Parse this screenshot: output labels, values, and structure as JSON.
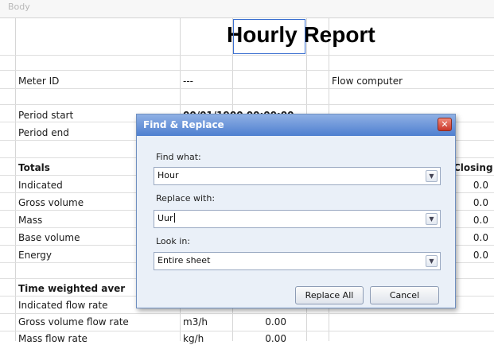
{
  "sheet": {
    "corner_label": "Body",
    "title": "Hourly Report",
    "meter_id_label": "Meter ID",
    "meter_id_value": "---",
    "flow_computer_label": "Flow computer",
    "period_start_label": "Period start",
    "period_start_value": "00/01/1900 00:00:00",
    "period_end_label": "Period end",
    "totals_label": "Totals",
    "closing_header": "Closing",
    "totals_rows": [
      {
        "label": "Indicated",
        "closing": "0.0"
      },
      {
        "label": "Gross volume",
        "closing": "0.0"
      },
      {
        "label": "Mass",
        "closing": "0.0"
      },
      {
        "label": "Base volume",
        "closing": "0.0"
      },
      {
        "label": "Energy",
        "closing": "0.0"
      }
    ],
    "time_weighted_label": "Time weighted aver",
    "flow_rows": [
      {
        "label": "Indicated flow rate",
        "unit": "",
        "value": ""
      },
      {
        "label": "Gross volume flow rate",
        "unit": "m3/h",
        "value": "0.00"
      },
      {
        "label": "Mass flow rate",
        "unit": "kg/h",
        "value": "0.00"
      }
    ]
  },
  "dialog": {
    "title": "Find & Replace",
    "close_symbol": "✕",
    "find_label": "Find what:",
    "find_value": "Hour",
    "replace_label": "Replace with:",
    "replace_value": "Uur",
    "look_in_label": "Look in:",
    "look_in_value": "Entire sheet",
    "replace_all_label": "Replace All",
    "cancel_label": "Cancel",
    "dropdown_symbol": "▼"
  }
}
